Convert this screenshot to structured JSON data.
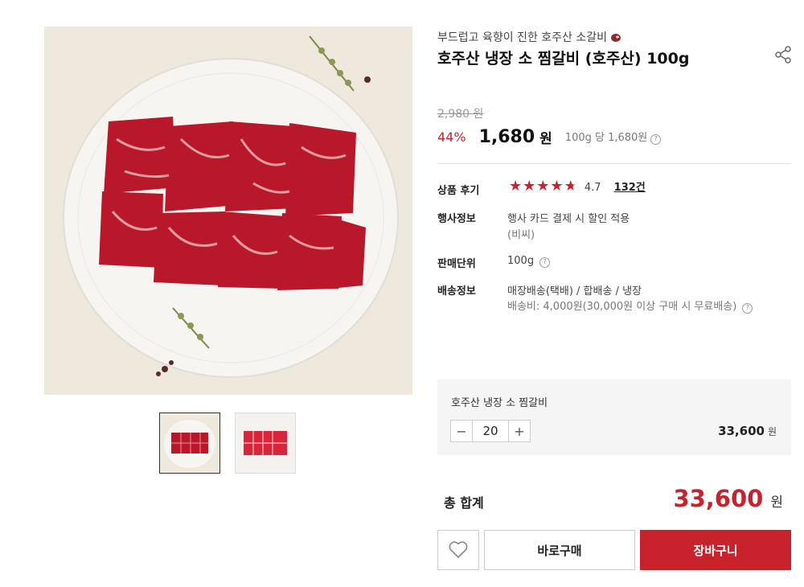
{
  "product": {
    "subtitle": "부드럽고 육향이 진한 호주산 소갈비",
    "title": "호주산 냉장 소 찜갈비 (호주산) 100g",
    "share_icon": "share-icon"
  },
  "price": {
    "original": "2,980 원",
    "discount": "44%",
    "current": "1,680",
    "currency": "원",
    "unit_price": "100g 당 1,680원"
  },
  "info": {
    "review_label": "상품 후기",
    "rating": "4.7",
    "rating_value": 4.7,
    "review_count": "132건",
    "event_label": "행사정보",
    "event_value": "행사 카드 결제 시 할인 적용",
    "event_sub": "(비씨)",
    "unit_label": "판매단위",
    "unit_value": "100g",
    "shipping_label": "배송정보",
    "shipping_value": "매장배송(택배) / 합배송 / 냉장",
    "shipping_fee": "배송비: 4,000원(30,000원 이상 구매 시 무료배송)"
  },
  "option": {
    "name": "호주산 냉장 소 찜갈비",
    "quantity": "20",
    "price": "33,600",
    "currency": "원"
  },
  "total": {
    "label": "총 합계",
    "price": "33,600",
    "currency": "원"
  },
  "actions": {
    "buy_now": "바로구매",
    "cart": "장바구니",
    "wish_icon": "heart-icon"
  },
  "colors": {
    "accent": "#c8232c"
  }
}
